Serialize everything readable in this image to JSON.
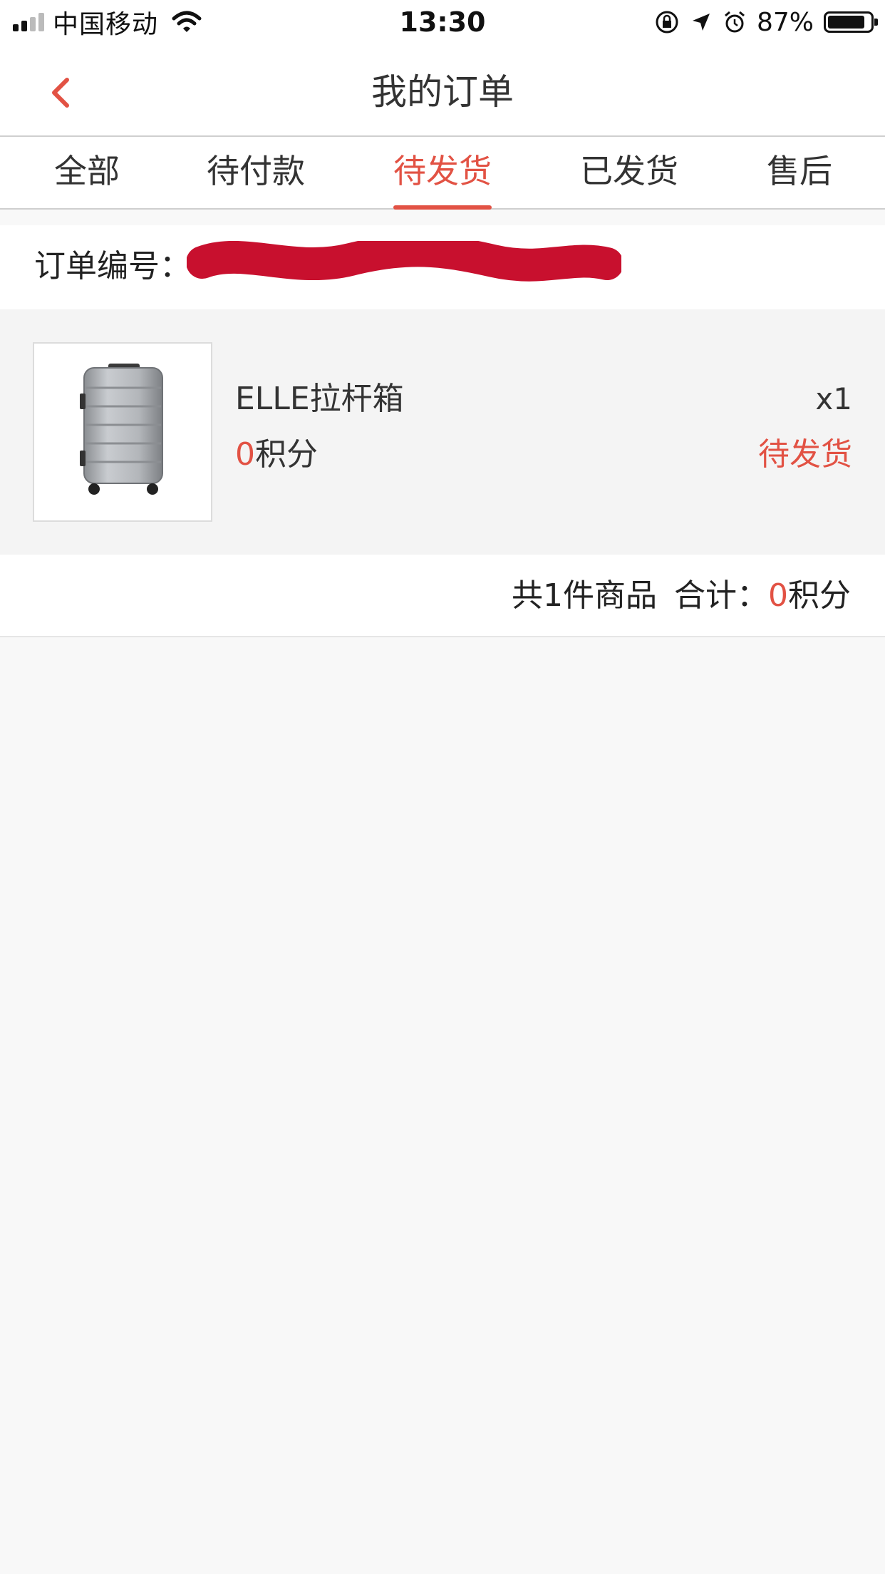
{
  "status_bar": {
    "carrier": "中国移动",
    "time": "13:30",
    "battery_percent": "87%",
    "icons": [
      "signal-icon",
      "wifi-icon",
      "rotation-lock-icon",
      "location-icon",
      "alarm-icon",
      "battery-icon"
    ]
  },
  "navbar": {
    "title": "我的订单",
    "back_icon": "chevron-left-icon"
  },
  "tabs": [
    {
      "label": "全部",
      "active": false
    },
    {
      "label": "待付款",
      "active": false
    },
    {
      "label": "待发货",
      "active": true
    },
    {
      "label": "已发货",
      "active": false
    },
    {
      "label": "售后",
      "active": false
    }
  ],
  "order": {
    "number_label": "订单编号：",
    "item": {
      "name": "ELLE拉杆箱",
      "points_value": "0",
      "points_unit": "积分",
      "quantity": "x1",
      "status": "待发货",
      "image_icon": "suitcase-icon"
    },
    "summary": {
      "count_text": "共1件商品",
      "total_label": "合计：",
      "total_value": "0",
      "total_unit": "积分"
    }
  },
  "colors": {
    "accent": "#e25244",
    "redaction": "#c8102e",
    "background": "#f8f8f8"
  }
}
